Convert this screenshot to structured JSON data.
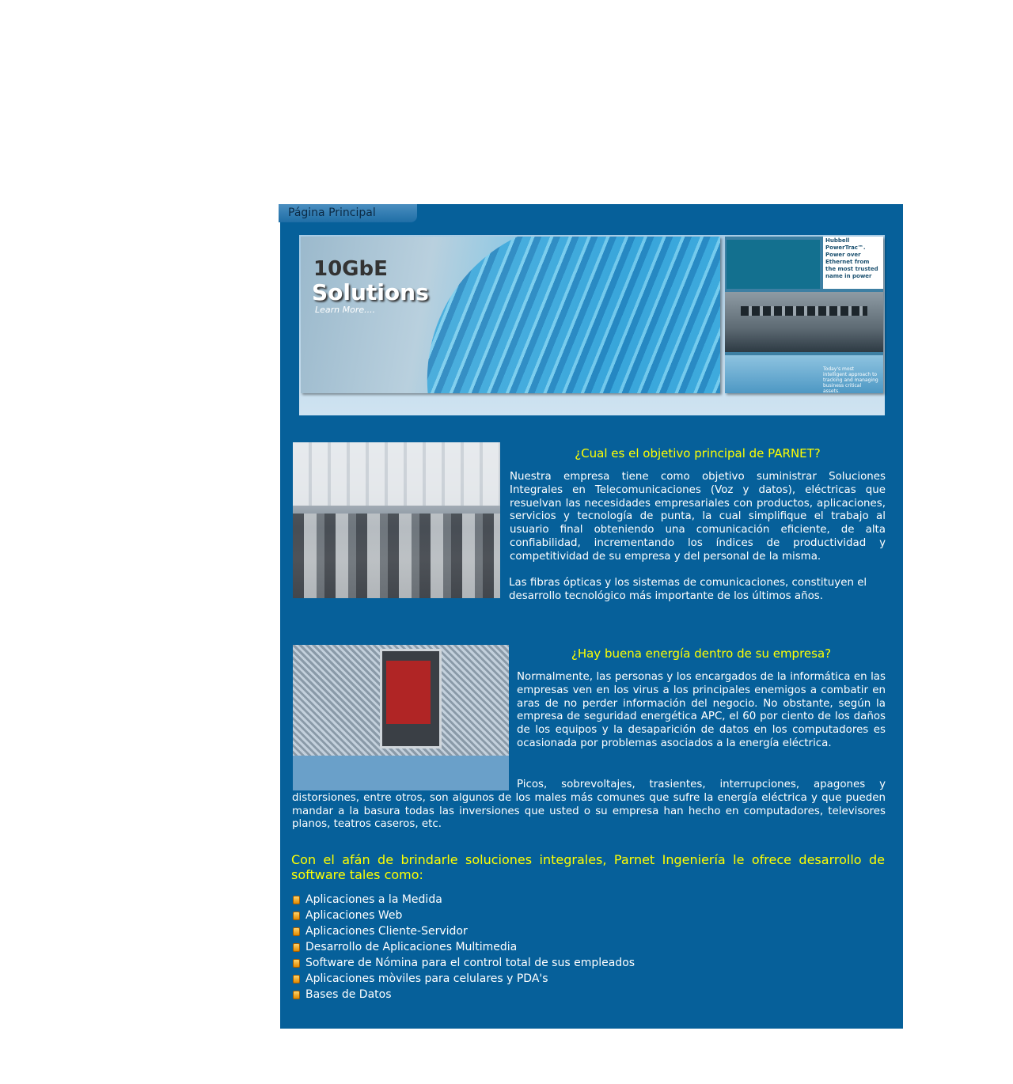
{
  "tab": {
    "label": "Página Principal"
  },
  "banner": {
    "title_line1": "10GbE",
    "title_line2": "Solutions",
    "learn_more": "Learn More....",
    "side_text": "Hubbell PowerTrac™. Power over Ethernet from the most trusted name in power",
    "side_small": "Today's most intelligent approach to tracking and managing business critical assets."
  },
  "section1": {
    "heading": "¿Cual es el objetivo principal de PARNET?",
    "p1": "Nuestra empresa tiene como objetivo suministrar Soluciones Integrales en Telecomunicaciones (Voz y datos), eléctricas que resuelvan las necesidades empresariales con productos, aplicaciones, servicios y tecnología de punta, la cual simplifique el trabajo al usuario final obteniendo una comunicación eficiente, de alta confiabilidad, incrementando los índices de productividad y competitividad de su empresa y del personal de la misma.",
    "p2": "Las fibras ópticas y los sistemas de comunicaciones, constituyen el desarrollo tecnológico más importante de los últimos años."
  },
  "section2": {
    "heading": "¿Hay buena energía dentro de su empresa?",
    "p1": "Normalmente, las personas y los encargados de la informática en las empresas ven en los virus a los principales enemigos a combatir en aras de no perder información del negocio. No obstante, según la empresa de seguridad energética APC, el 60 por ciento de los daños de los equipos y la desaparición de datos en los computadores es ocasionada por problemas asociados a la energía eléctrica.",
    "p2": "Picos, sobrevoltajes, trasientes, interrupciones, apagones y distorsiones, entre otros, son algunos de los males más comunes que sufre la energía eléctrica y que pueden mandar a la basura todas las inversiones que usted o su empresa han hecho en computadores, televisores planos, teatros caseros, etc."
  },
  "intro": "Con el afán de brindarle soluciones integrales, Parnet Ingeniería le ofrece desarrollo de software tales como:",
  "services": [
    "Aplicaciones a la Medida",
    "Aplicaciones Web",
    "Aplicaciones Cliente-Servidor",
    "Desarrollo de Aplicaciones Multimedia",
    "Software de Nómina para el control total de sus empleados",
    "Aplicaciones mòviles para celulares y PDA's",
    "Bases de Datos"
  ],
  "colors": {
    "panel": "#06609a",
    "heading": "#ffff00",
    "text": "#ffffff"
  }
}
